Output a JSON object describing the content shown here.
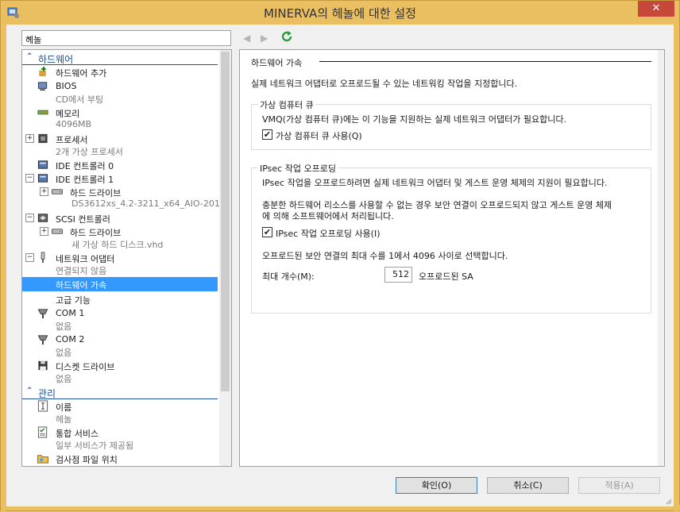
{
  "window": {
    "title": "MINERVA의 헤놀에 대한 설정",
    "close": "✕"
  },
  "toolbar": {
    "vm_selector": "헤놀",
    "back": "◀",
    "forward": "▶"
  },
  "tree": {
    "hardware_header": "하드웨어",
    "management_header": "관리",
    "items": {
      "add_hw": "하드웨어 추가",
      "bios": "BIOS",
      "bios_sub": "CD에서 부팅",
      "memory": "메모리",
      "memory_sub": "4096MB",
      "cpu": "프로세서",
      "cpu_sub": "2개 가상 프로세서",
      "ide0": "IDE 컨트롤러 0",
      "ide1": "IDE 컨트롤러 1",
      "hdd1": "하드 드라이브",
      "hdd1_sub": "DS3612xs_4.2-3211_x64_AIO-201...",
      "scsi": "SCSI 컨트롤러",
      "hdd2": "하드 드라이브",
      "hdd2_sub": "새 가상 하드 디스크.vhd",
      "nic": "네트워크 어댑터",
      "nic_sub": "연결되지 않음",
      "hw_accel": "하드웨어 가속",
      "advanced": "고급 기능",
      "com1": "COM 1",
      "com1_sub": "없음",
      "com2": "COM 2",
      "com2_sub": "없음",
      "floppy": "디스켓 드라이브",
      "floppy_sub": "없음",
      "name": "이름",
      "name_sub": "헤놀",
      "integration": "통합 서비스",
      "integration_sub": "일부 서비스가 제공됨",
      "checkpoint": "검사점 파일 위치"
    },
    "expand_plus": "+",
    "expand_minus": "−"
  },
  "panel": {
    "title": "하드웨어 가속",
    "description": "실제 네트워크 어댑터로 오프로드될 수 있는 네트워킹 작업을 지정합니다.",
    "vmq": {
      "legend": "가상 컴퓨터 큐",
      "text": "VMQ(가상 컴퓨터 큐)에는 이 기능을 지원하는 실제 네트워크 어댑터가 필요합니다.",
      "checkbox_label": "가상 컴퓨터 큐 사용(Q)",
      "checked": "✔"
    },
    "ipsec": {
      "legend": "IPsec 작업 오프로딩",
      "text1": "IPsec 작업을 오프로드하려면 실제 네트워크 어댑터 및 게스트 운영 체제의 지원이 필요합니다.",
      "text2a": "충분한 하드웨어 리소스를 사용할 수 없는 경우 보안 연결이 오프로드되지 않고 게스트 운영 체제",
      "text2b": "에 의해 소프트웨어에서 처리됩니다.",
      "checkbox_label": "IPsec 작업 오프로딩 사용(I)",
      "checked": "✔",
      "range_text": "오프로드된 보안 연결의 최대 수를 1에서 4096 사이로 선택합니다.",
      "max_label": "최대 개수(M):",
      "max_value": "512",
      "unit": "오프로드된 SA"
    }
  },
  "buttons": {
    "ok": "확인(O)",
    "cancel": "취소(C)",
    "apply": "적용(A)"
  },
  "colors": {
    "titlebar": "#eabf62",
    "accent": "#1c4f9c",
    "selection": "#3399ff",
    "close": "#c7473a"
  }
}
